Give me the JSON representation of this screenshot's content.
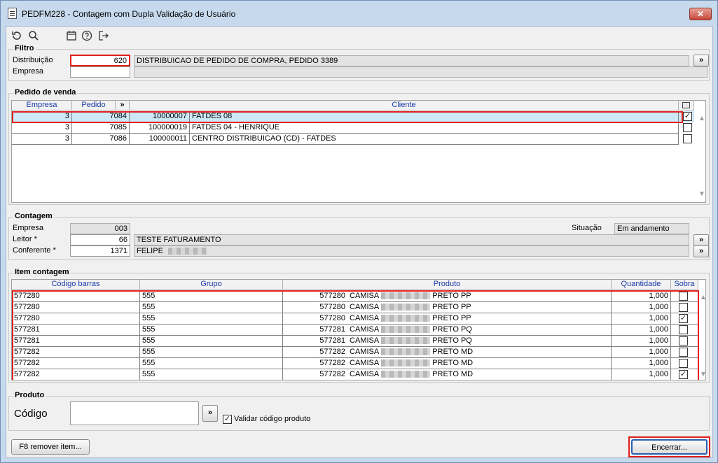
{
  "window": {
    "title": "PEDFM228 - Contagem com Dupla Validação de Usuário",
    "close_label": "✕"
  },
  "toolbar": {
    "refresh_icon": "refresh-icon",
    "search_icon": "search-icon",
    "calendar_icon": "calendar-icon",
    "help_icon": "help-icon",
    "exit_icon": "exit-icon"
  },
  "filtro": {
    "legend": "Filtro",
    "distribuicao_label": "Distribuição",
    "distribuicao_value": "620",
    "distribuicao_desc": "DISTRIBUICAO DE PEDIDO DE COMPRA, PEDIDO 3389",
    "empresa_label": "Empresa",
    "empresa_value": "",
    "empresa_desc": "",
    "expand_label": "»"
  },
  "pedido": {
    "legend": "Pedido de venda",
    "headers": {
      "empresa": "Empresa",
      "pedido": "Pedido",
      "expand": "»",
      "cliente": "Cliente"
    },
    "rows": [
      {
        "empresa": "3",
        "pedido": "7084",
        "cod": "10000007",
        "cliente": "FATDES 08",
        "checked": "✓"
      },
      {
        "empresa": "3",
        "pedido": "7085",
        "cod": "100000019",
        "cliente": "FATDES 04 - HENRIQUE",
        "checked": ""
      },
      {
        "empresa": "3",
        "pedido": "7086",
        "cod": "100000011",
        "cliente": "CENTRO DISTRIBUICAO (CD) - FATDES",
        "checked": ""
      }
    ]
  },
  "contagem": {
    "legend": "Contagem",
    "empresa_label": "Empresa",
    "empresa_value": "003",
    "situacao_label": "Situação",
    "situacao_value": "Em andamento",
    "leitor_label": "Leitor *",
    "leitor_value": "66",
    "leitor_desc": "TESTE FATURAMENTO",
    "conferente_label": "Conferente *",
    "conferente_value": "1371",
    "conferente_desc": "FELIPE",
    "expand_label": "»"
  },
  "itens": {
    "legend": "Item contagem",
    "headers": {
      "codigo": "Código barras",
      "grupo": "Grupo",
      "produto": "Produto",
      "quantidade": "Quantidade",
      "sobra": "Sobra"
    },
    "rows": [
      {
        "codigo": "577280",
        "grupo": "555",
        "prod_cod": "577280",
        "prod_a": "CAMISA",
        "prod_b": "PRETO PP",
        "quantidade": "1,000",
        "sobra": ""
      },
      {
        "codigo": "577280",
        "grupo": "555",
        "prod_cod": "577280",
        "prod_a": "CAMISA",
        "prod_b": "PRETO PP",
        "quantidade": "1,000",
        "sobra": ""
      },
      {
        "codigo": "577280",
        "grupo": "555",
        "prod_cod": "577280",
        "prod_a": "CAMISA",
        "prod_b": "PRETO PP",
        "quantidade": "1,000",
        "sobra": "✓"
      },
      {
        "codigo": "577281",
        "grupo": "555",
        "prod_cod": "577281",
        "prod_a": "CAMISA",
        "prod_b": "PRETO PQ",
        "quantidade": "1,000",
        "sobra": ""
      },
      {
        "codigo": "577281",
        "grupo": "555",
        "prod_cod": "577281",
        "prod_a": "CAMISA",
        "prod_b": "PRETO PQ",
        "quantidade": "1,000",
        "sobra": ""
      },
      {
        "codigo": "577282",
        "grupo": "555",
        "prod_cod": "577282",
        "prod_a": "CAMISA",
        "prod_b": "PRETO MD",
        "quantidade": "1,000",
        "sobra": ""
      },
      {
        "codigo": "577282",
        "grupo": "555",
        "prod_cod": "577282",
        "prod_a": "CAMISA",
        "prod_b": "PRETO MD",
        "quantidade": "1,000",
        "sobra": ""
      },
      {
        "codigo": "577282",
        "grupo": "555",
        "prod_cod": "577282",
        "prod_a": "CAMISA",
        "prod_b": "PRETO MD",
        "quantidade": "1,000",
        "sobra": "✓"
      }
    ]
  },
  "produto": {
    "legend": "Produto",
    "codigo_label": "Código",
    "codigo_value": "",
    "expand_label": "»",
    "validar_label": "Validar código produto",
    "validar_checked": "✓"
  },
  "footer": {
    "remover_label": "F8 remover item...",
    "encerrar_label": "Encerrar..."
  },
  "colors": {
    "accent_red": "#e0201c",
    "header_blue": "#1a3aa8",
    "selected_row": "#cde8f7"
  }
}
